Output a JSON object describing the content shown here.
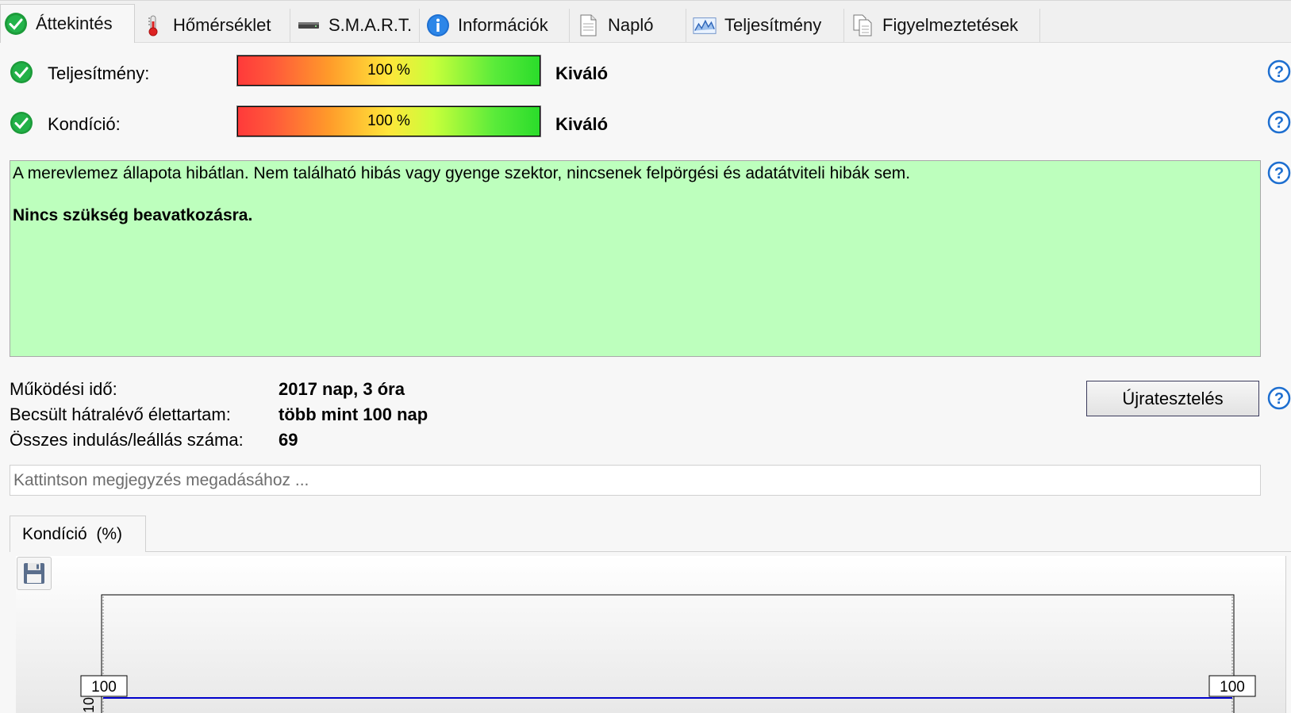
{
  "tabs": [
    {
      "label": "Áttekintés",
      "icon": "check-icon",
      "active": true
    },
    {
      "label": "Hőmérséklet",
      "icon": "thermometer-icon"
    },
    {
      "label": "S.M.A.R.T.",
      "icon": "drive-icon"
    },
    {
      "label": "Információk",
      "icon": "info-icon"
    },
    {
      "label": "Napló",
      "icon": "document-icon"
    },
    {
      "label": "Teljesítmény",
      "icon": "performance-chart-icon"
    },
    {
      "label": "Figyelmeztetések",
      "icon": "copy-documents-icon"
    }
  ],
  "status": {
    "performance": {
      "label": "Teljesítmény:",
      "percent": 100,
      "percent_text": "100 %",
      "rating": "Kiváló"
    },
    "condition": {
      "label": "Kondíció:",
      "percent": 100,
      "percent_text": "100 %",
      "rating": "Kiváló"
    }
  },
  "message": {
    "line1": "A merevlemez állapota hibátlan. Nem található hibás vagy gyenge szektor, nincsenek felpörgési és adatátviteli hibák sem.",
    "line2": "Nincs szükség beavatkozásra.",
    "background": "#bdffbd"
  },
  "stats": {
    "uptime_label": "Működési idő:",
    "uptime_value": "2017 nap, 3 óra",
    "lifetime_label": "Becsült hátralévő élettartam:",
    "lifetime_value": "több mint 100 nap",
    "startstop_label": "Összes indulás/leállás száma:",
    "startstop_value": "69"
  },
  "retest_label": "Újratesztelés",
  "note_placeholder": "Kattintson megjegyzés megadásához ...",
  "chart_tab": {
    "label": "Kondíció  (%)"
  },
  "chart_data": {
    "type": "line",
    "series": [
      {
        "values": [
          100,
          100
        ]
      }
    ],
    "start_label": "100",
    "end_label": "100",
    "y_tick_partial": "10",
    "line_color": "#0000cc"
  }
}
